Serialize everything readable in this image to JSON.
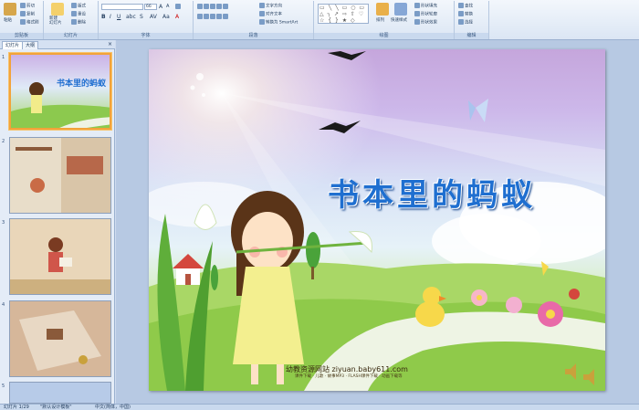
{
  "ribbon": {
    "groups": {
      "clipboard": "剪贴板",
      "slides": "幻灯片",
      "font": "字体",
      "paragraph": "段落",
      "drawing": "绘图",
      "editing": "编辑"
    },
    "paste": "粘贴",
    "cut": "剪切",
    "copy": "复制",
    "format_painter": "格式刷",
    "new_slide": "新建\n幻灯片",
    "layout": "版式",
    "reset": "重设",
    "delete": "删除",
    "font_name": "",
    "font_size": "66",
    "text_direction": "文字方向",
    "align_text": "对齐文本",
    "convert_smartart": "转换为 SmartArt",
    "arrange": "排列",
    "quick_styles": "快速样式",
    "shape_fill": "形状填充",
    "shape_outline": "形状轮廓",
    "shape_effects": "形状效果",
    "find": "查找",
    "replace": "替换",
    "select": "选择"
  },
  "panel": {
    "tab_slides": "幻灯片",
    "tab_outline": "大纲",
    "close": "×",
    "slide_numbers": [
      "1",
      "2",
      "3",
      "4",
      "5"
    ]
  },
  "slide": {
    "title": "书本里的蚂蚁",
    "footer_main": "幼教资源网站  ziyuan.baby611.com",
    "footer_sub": "课件下载 · 儿歌 · 故事MP3 · FLASH课件下载 · 动画下载等"
  },
  "status": {
    "slide_count": "幻灯片 1/29",
    "theme": "\"默认设计模板\"",
    "language": "中文(简体，中国)"
  },
  "colors": {
    "title": "#1f6fd0",
    "ribbon_bg": "#dbe6f4",
    "selected_thumb_border": "#f2a33a"
  }
}
